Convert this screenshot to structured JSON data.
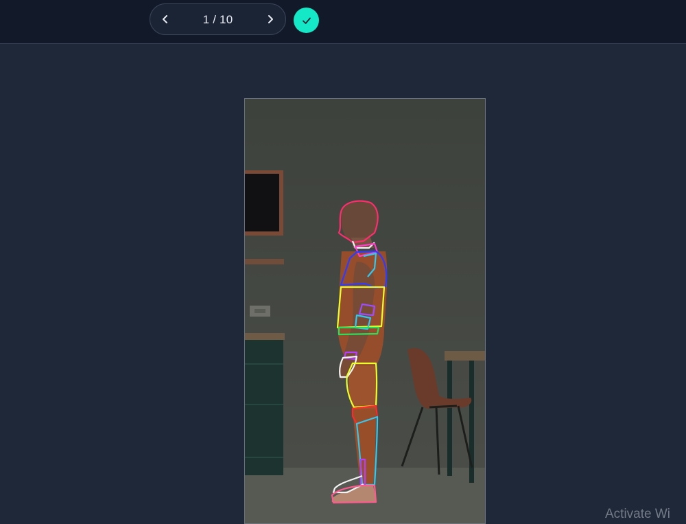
{
  "toolbar": {
    "prev_icon": "chevron-left-icon",
    "page_current": 1,
    "page_total": 10,
    "page_indicator": "1 / 10",
    "next_icon": "chevron-right-icon",
    "confirm_icon": "check-icon",
    "accent_color": "#14e8c6"
  },
  "canvas": {
    "subject": "man standing in profile with colored body-segment annotation outlines",
    "segment_colors": [
      "#ff2d6e",
      "#2f3bff",
      "#e8ff2a",
      "#28e05a",
      "#9b4dff",
      "#2fc9f2",
      "#ff2a2a",
      "#f4f4f4",
      "#b63dff"
    ]
  },
  "watermark": {
    "text": "Activate Wi"
  }
}
